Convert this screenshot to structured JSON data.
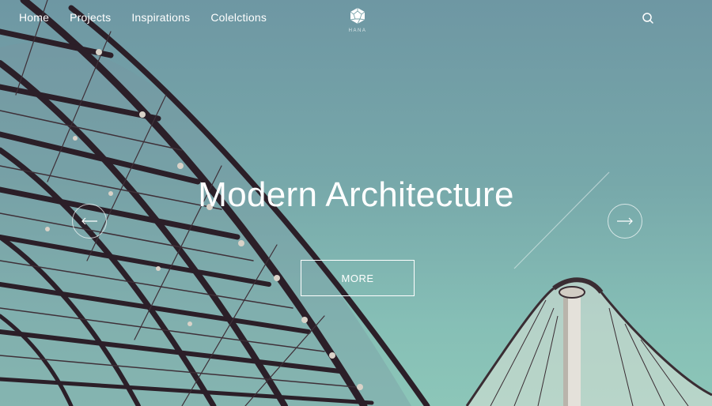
{
  "nav": {
    "items": [
      {
        "label": "Home"
      },
      {
        "label": "Projects"
      },
      {
        "label": "Inspirations"
      },
      {
        "label": "Colelctions"
      }
    ]
  },
  "brand": {
    "logo_text": "HANA"
  },
  "hero": {
    "title": "Modern Architecture",
    "cta_label": "MORE",
    "prev_icon": "arrow-left-icon",
    "next_icon": "arrow-right-icon"
  },
  "icons": {
    "search": "search-icon",
    "logo": "polyhedron-logo-icon"
  },
  "colors": {
    "text": "#ffffff",
    "sky_top": "#6e97a3",
    "sky_bottom": "#8cc6b8",
    "structure": "#2b1f28"
  }
}
